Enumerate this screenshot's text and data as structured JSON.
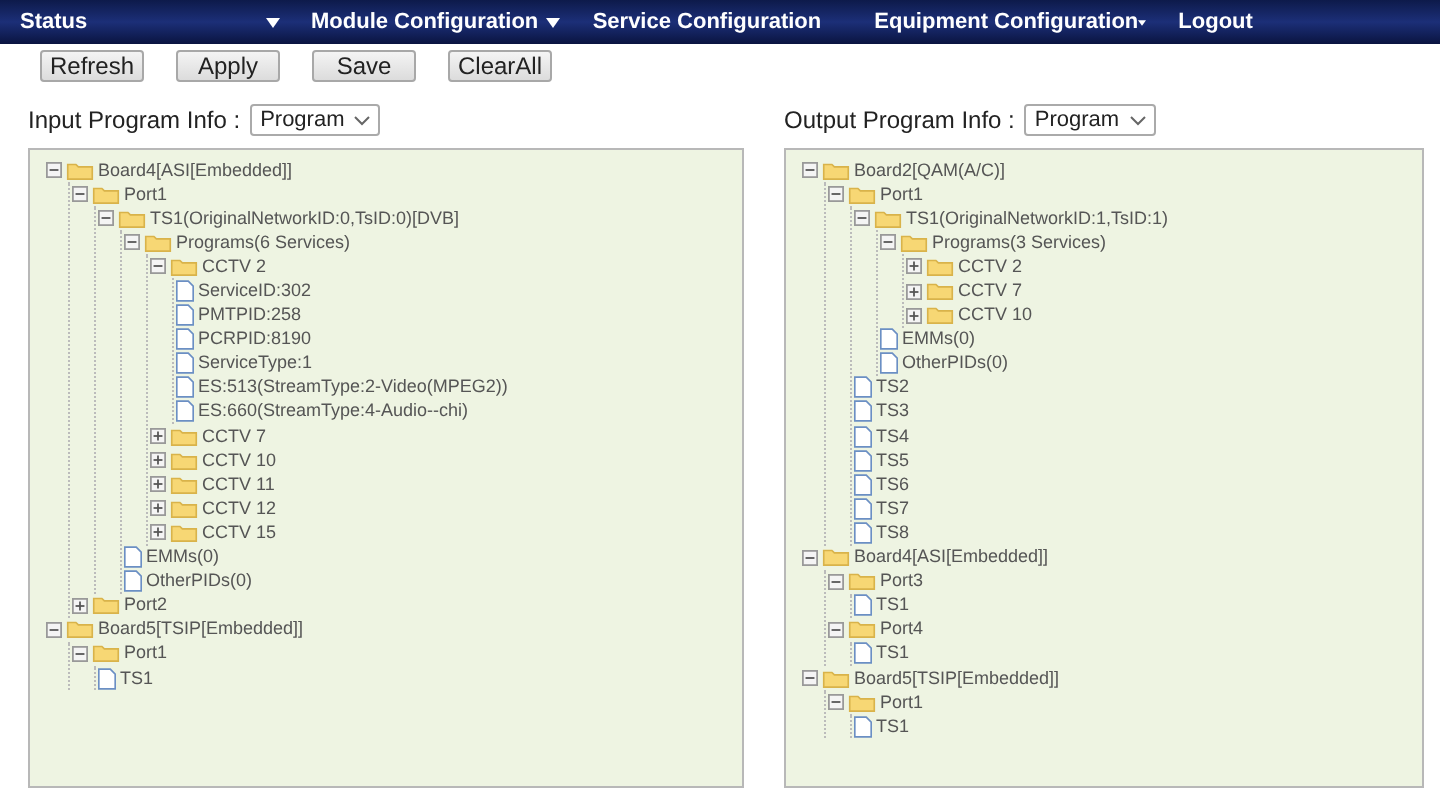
{
  "nav": [
    {
      "label": "Status",
      "has_menu": true
    },
    {
      "label": "Module Configuration",
      "has_menu": true
    },
    {
      "label": "Service Configuration",
      "has_menu": false
    },
    {
      "label": "Equipment Configuration",
      "has_menu": true
    },
    {
      "label": "Logout",
      "has_menu": false
    }
  ],
  "buttons": [
    "Refresh",
    "Apply",
    "Save",
    "ClearAll"
  ],
  "panels": [
    {
      "label": "Input Program Info :",
      "select": "Program",
      "tree": [
        {
          "label": "Board4[ASI[Embedded]]",
          "kind": "folder",
          "expanded": true,
          "children": [
            {
              "label": "Port1",
              "kind": "folder",
              "expanded": true,
              "children": [
                {
                  "label": "TS1(OriginalNetworkID:0,TsID:0)[DVB]",
                  "kind": "folder",
                  "expanded": true,
                  "children": [
                    {
                      "label": "Programs(6 Services)",
                      "kind": "folder",
                      "expanded": true,
                      "children": [
                        {
                          "label": "CCTV 2",
                          "kind": "folder",
                          "expanded": true,
                          "children": [
                            {
                              "label": "ServiceID:302",
                              "kind": "file"
                            },
                            {
                              "label": "PMTPID:258",
                              "kind": "file"
                            },
                            {
                              "label": "PCRPID:8190",
                              "kind": "file"
                            },
                            {
                              "label": "ServiceType:1",
                              "kind": "file"
                            },
                            {
                              "label": "ES:513(StreamType:2-Video(MPEG2))",
                              "kind": "file"
                            },
                            {
                              "label": "ES:660(StreamType:4-Audio--chi)",
                              "kind": "file"
                            }
                          ]
                        },
                        {
                          "label": "CCTV 7",
                          "kind": "folder",
                          "expanded": false
                        },
                        {
                          "label": "CCTV 10",
                          "kind": "folder",
                          "expanded": false
                        },
                        {
                          "label": "CCTV 11",
                          "kind": "folder",
                          "expanded": false
                        },
                        {
                          "label": "CCTV 12",
                          "kind": "folder",
                          "expanded": false
                        },
                        {
                          "label": "CCTV 15",
                          "kind": "folder",
                          "expanded": false
                        }
                      ]
                    },
                    {
                      "label": "EMMs(0)",
                      "kind": "file"
                    },
                    {
                      "label": "OtherPIDs(0)",
                      "kind": "file"
                    }
                  ]
                }
              ]
            },
            {
              "label": "Port2",
              "kind": "folder",
              "expanded": false
            }
          ]
        },
        {
          "label": "Board5[TSIP[Embedded]]",
          "kind": "folder",
          "expanded": true,
          "children": [
            {
              "label": "Port1",
              "kind": "folder",
              "expanded": true,
              "children": [
                {
                  "label": "TS1",
                  "kind": "file"
                }
              ]
            }
          ]
        }
      ]
    },
    {
      "label": "Output Program Info :",
      "select": "Program",
      "tree": [
        {
          "label": "Board2[QAM(A/C)]",
          "kind": "folder",
          "expanded": true,
          "children": [
            {
              "label": "Port1",
              "kind": "folder",
              "expanded": true,
              "children": [
                {
                  "label": "TS1(OriginalNetworkID:1,TsID:1)",
                  "kind": "folder",
                  "expanded": true,
                  "children": [
                    {
                      "label": "Programs(3 Services)",
                      "kind": "folder",
                      "expanded": true,
                      "children": [
                        {
                          "label": "CCTV 2",
                          "kind": "folder",
                          "expanded": false
                        },
                        {
                          "label": "CCTV 7",
                          "kind": "folder",
                          "expanded": false
                        },
                        {
                          "label": "CCTV 10",
                          "kind": "folder",
                          "expanded": false
                        }
                      ]
                    },
                    {
                      "label": "EMMs(0)",
                      "kind": "file"
                    },
                    {
                      "label": "OtherPIDs(0)",
                      "kind": "file"
                    }
                  ]
                },
                {
                  "label": "TS2",
                  "kind": "file"
                },
                {
                  "label": "TS3",
                  "kind": "file"
                },
                {
                  "label": "TS4",
                  "kind": "file"
                },
                {
                  "label": "TS5",
                  "kind": "file"
                },
                {
                  "label": "TS6",
                  "kind": "file"
                },
                {
                  "label": "TS7",
                  "kind": "file"
                },
                {
                  "label": "TS8",
                  "kind": "file"
                }
              ]
            }
          ]
        },
        {
          "label": "Board4[ASI[Embedded]]",
          "kind": "folder",
          "expanded": true,
          "children": [
            {
              "label": "Port3",
              "kind": "folder",
              "expanded": true,
              "children": [
                {
                  "label": "TS1",
                  "kind": "file"
                }
              ]
            },
            {
              "label": "Port4",
              "kind": "folder",
              "expanded": true,
              "children": [
                {
                  "label": "TS1",
                  "kind": "file"
                }
              ]
            }
          ]
        },
        {
          "label": "Board5[TSIP[Embedded]]",
          "kind": "folder",
          "expanded": true,
          "children": [
            {
              "label": "Port1",
              "kind": "folder",
              "expanded": true,
              "children": [
                {
                  "label": "TS1",
                  "kind": "file"
                }
              ]
            }
          ]
        }
      ]
    }
  ]
}
